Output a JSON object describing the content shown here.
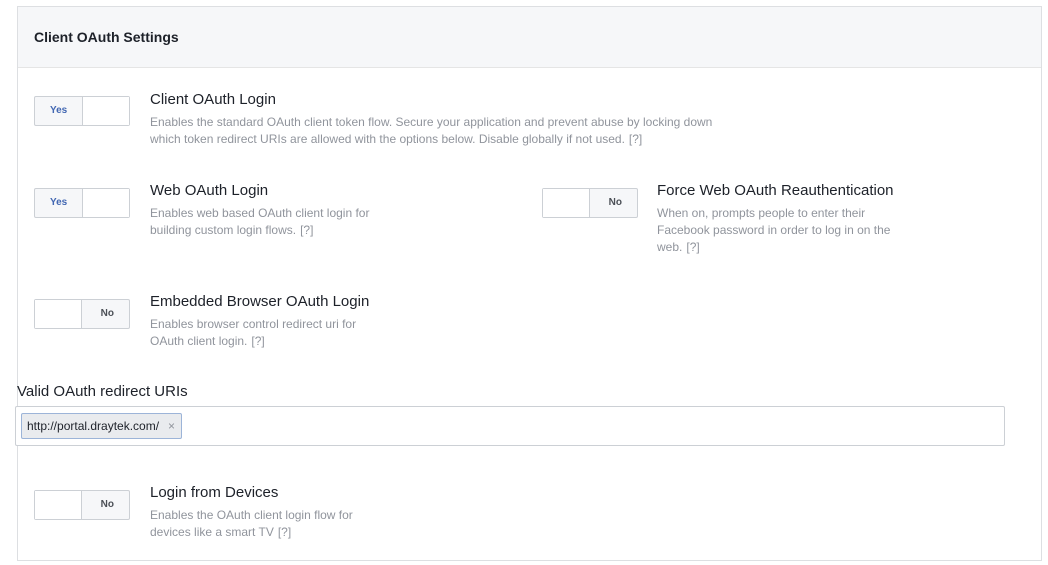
{
  "panel": {
    "title": "Client OAuth Settings"
  },
  "options": [
    {
      "title": "Client OAuth Login",
      "desc_lines": [
        "Enables the standard OAuth client token flow. Secure your application and prevent abuse by locking down",
        "which token redirect URIs are allowed with the options below. Disable globally if not used."
      ],
      "toggle": "Yes",
      "help": "[?]"
    },
    {
      "title": "Web OAuth Login",
      "desc_lines": [
        "Enables web based OAuth client login for",
        "building custom login flows."
      ],
      "toggle": "Yes",
      "help": "[?]"
    },
    {
      "title": "Force Web OAuth Reauthentication",
      "desc_lines": [
        "When on, prompts people to enter their",
        "Facebook password in order to log in on the",
        "web."
      ],
      "toggle": "No",
      "help": "[?]"
    },
    {
      "title": "Embedded Browser OAuth Login",
      "desc_lines": [
        "Enables browser control redirect uri for",
        "OAuth client login."
      ],
      "toggle": "No",
      "help": "[?]"
    },
    {
      "title": "Login from Devices",
      "desc_lines": [
        "Enables the OAuth client login flow for",
        "devices like a smart TV"
      ],
      "toggle": "No",
      "help": "[?]"
    }
  ],
  "redirect_uris": {
    "label": "Valid OAuth redirect URIs",
    "tokens": [
      "http://portal.draytek.com/"
    ],
    "remove_glyph": "×"
  }
}
